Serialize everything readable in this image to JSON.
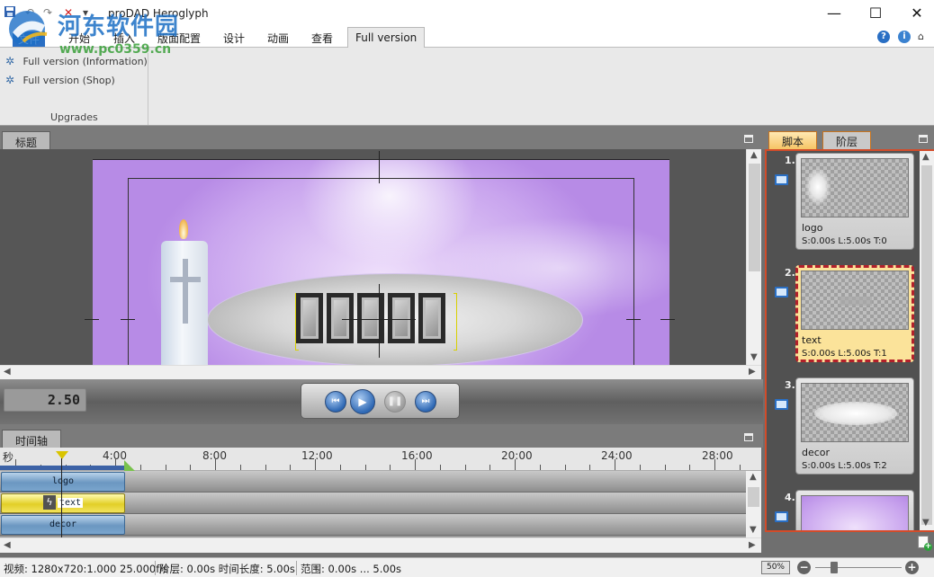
{
  "window": {
    "title": "proDAD Heroglyph",
    "minimize": "—",
    "maximize": "☐",
    "close": "✕"
  },
  "quick_access": {
    "save_icon": "save-icon",
    "undo_icon": "undo-icon",
    "redo_icon": "redo-icon",
    "delete_icon": "delete-icon",
    "customize": "▾"
  },
  "menu": {
    "file": "文件",
    "tabs": [
      {
        "label": "开始"
      },
      {
        "label": "插入"
      },
      {
        "label": "版面配置"
      },
      {
        "label": "设计"
      },
      {
        "label": "动画"
      },
      {
        "label": "查看"
      },
      {
        "label": "Full version"
      }
    ],
    "active_tab": "Full version"
  },
  "ribbon": {
    "items": [
      {
        "label": "Full version (Information)",
        "icon": "info-gear-icon"
      },
      {
        "label": "Full version (Shop)",
        "icon": "shop-gear-icon"
      }
    ],
    "group_label": "Upgrades"
  },
  "watermark": {
    "site_cn": "河东软件园",
    "site_url": "www.pc0359.cn"
  },
  "title_panel": {
    "tab_label": "标题"
  },
  "playback": {
    "time": "2.50"
  },
  "timeline": {
    "tab_label": "时间轴",
    "unit": "秒",
    "ticks": [
      "4:00",
      "8:00",
      "12:00",
      "16:00",
      "20:00",
      "24:00",
      "28:00"
    ],
    "tracks": [
      {
        "label": "logo",
        "selected": false
      },
      {
        "label": "text",
        "selected": true
      },
      {
        "label": "decor",
        "selected": false
      }
    ]
  },
  "right_panel": {
    "tabs": [
      {
        "label": "脚本",
        "active": true
      },
      {
        "label": "阶层",
        "active": false
      }
    ],
    "cards": [
      {
        "num": "1.",
        "name": "logo",
        "meta": "S:0.00s  L:5.00s  T:0",
        "selected": false
      },
      {
        "num": "2.",
        "name": "text",
        "meta": "S:0.00s  L:5.00s  T:1",
        "selected": true
      },
      {
        "num": "3.",
        "name": "decor",
        "meta": "S:0.00s  L:5.00s  T:2",
        "selected": false
      },
      {
        "num": "4.",
        "name": "",
        "meta": "",
        "selected": false
      }
    ]
  },
  "status": {
    "video": "视频: 1280x720:1.000  25.000f/s",
    "layer": "阶层: 0.00s  时间长度: 5.00s",
    "range": "范围: 0.00s ... 5.00s",
    "zoom": "50%",
    "zoom_level": 0.2
  }
}
